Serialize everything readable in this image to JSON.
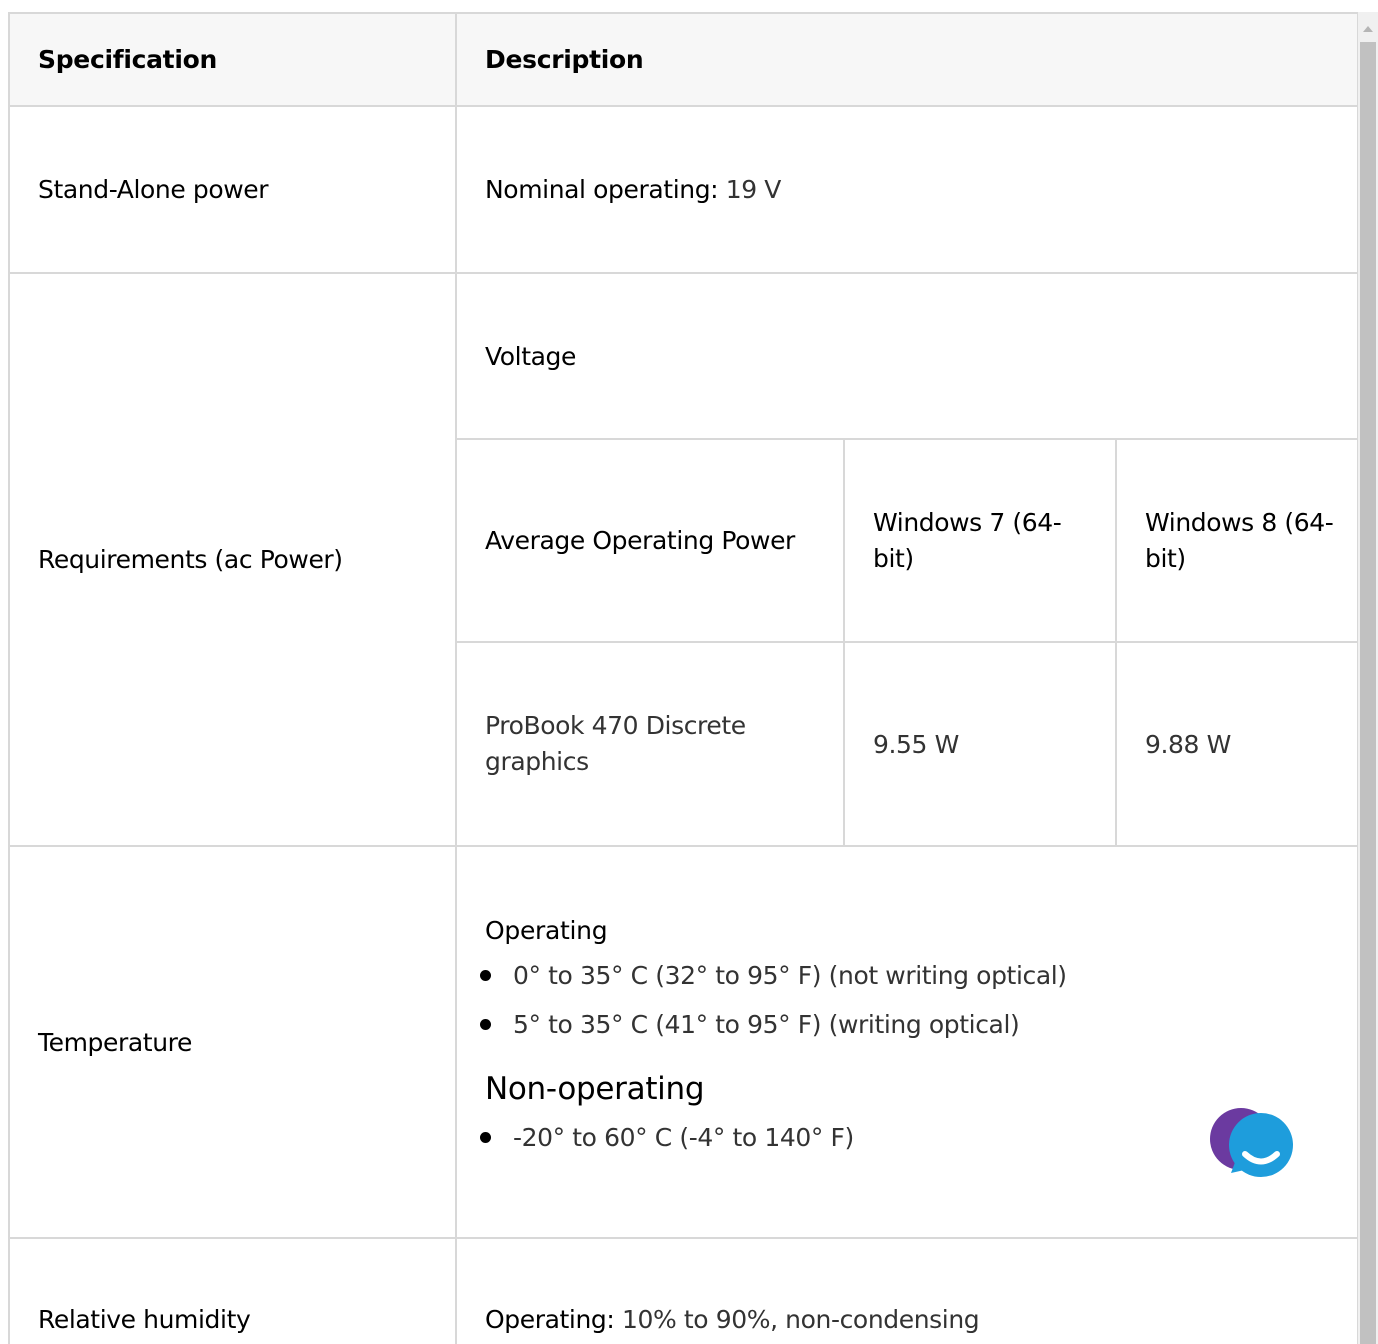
{
  "table": {
    "headers": {
      "specification": "Specification",
      "description": "Description"
    },
    "rows": {
      "standalone": {
        "label": "Stand-Alone power",
        "key": "Nominal operating",
        "sep": ": ",
        "value": "19 V"
      },
      "requirements": {
        "label": "Requirements (ac Power)",
        "voltage": "Voltage",
        "power_header": [
          "Average Operating Power",
          "Windows 7 (64-bit)",
          "Windows 8 (64-bit)"
        ],
        "power_row": [
          "ProBook 470 Discrete graphics",
          "9.55 W",
          "9.88 W"
        ]
      },
      "temperature": {
        "label": "Temperature",
        "operating_heading": "Operating",
        "operating_items": [
          "0° to 35° C (32° to 95° F) (not writing optical)",
          "5° to 35° C (41° to 95° F) (writing optical)"
        ],
        "nonoperating_heading": "Non-operating",
        "nonoperating_items": [
          "-20° to 60° C (-4° to 140° F)"
        ]
      },
      "humidity": {
        "label": "Relative humidity",
        "key": "Operating",
        "sep": ": ",
        "value": "10% to 90%, non-condensing"
      }
    }
  },
  "chat_widget": {
    "icon": "chat-bubble-icon",
    "colors": {
      "back": "#6b3aa0",
      "front": "#1e9ddc"
    }
  },
  "colors": {
    "border": "#d8d8d8",
    "header_bg": "#f7f7f7",
    "value_text": "#333333"
  }
}
